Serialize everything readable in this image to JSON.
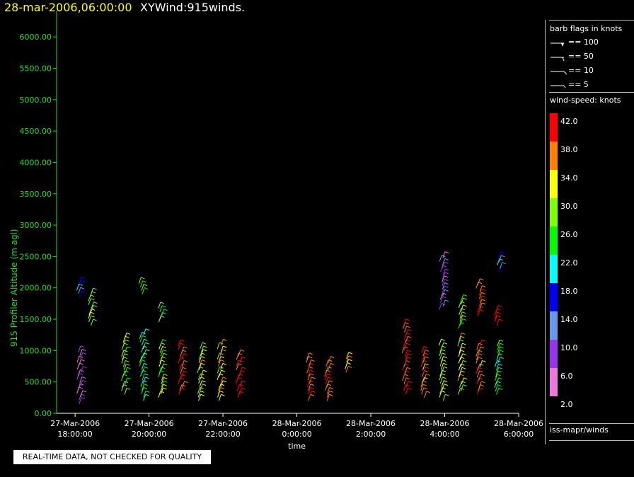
{
  "header": {
    "datetime": "28-mar-2006,06:00:00",
    "plot_name": "XYWind:915winds."
  },
  "disclaimer": "REAL-TIME DATA, NOT CHECKED FOR QUALITY",
  "legend": {
    "barb_title": "barb flags in knots",
    "barb_items": [
      "== 100",
      "== 50",
      "== 10",
      "== 5"
    ],
    "speed_title": "wind-speed: knots",
    "speed_labels": [
      "42.0",
      "38.0",
      "34.0",
      "30.0",
      "26.0",
      "22.0",
      "18.0",
      "14.0",
      "10.0",
      "6.0",
      "2.0"
    ],
    "speed_colors": [
      "#ff0000",
      "#ff8000",
      "#ffff00",
      "#80ff00",
      "#00ff00",
      "#00ffff",
      "#0000ff",
      "#6699ee",
      "#9933ee",
      "#ee77dd"
    ],
    "source": "iss-mapr/winds"
  },
  "colors": {
    "axis_y": "#22dd22",
    "axis_x": "#ffffff",
    "title_date": "#ffff00"
  },
  "chart_data": {
    "type": "scatter",
    "title": "28-mar-2006,06:00:00  XYWind:915winds.",
    "ylabel": "915 Profiler Altitude (m agl)",
    "xlabel": "time",
    "ylim": [
      0,
      6250
    ],
    "yticks": [
      "0.00",
      "500.00",
      "1000.00",
      "1500.00",
      "2000.00",
      "2500.00",
      "3000.00",
      "3500.00",
      "4000.00",
      "4500.00",
      "5000.00",
      "5500.00",
      "6000.00"
    ],
    "x_range_hours": [
      -0.25,
      6.0
    ],
    "xticks": [
      {
        "h": 0,
        "l1": "27-Mar-2006",
        "l2": "18:00:00"
      },
      {
        "h": 1,
        "l1": "27-Mar-2006",
        "l2": "20:00:00"
      },
      {
        "h": 2,
        "l1": "27-Mar-2006",
        "l2": "22:00:00"
      },
      {
        "h": 3,
        "l1": "28-Mar-2006",
        "l2": "0:00:00"
      },
      {
        "h": 4,
        "l1": "28-Mar-2006",
        "l2": "2:00:00"
      },
      {
        "h": 5,
        "l1": "28-Mar-2006",
        "l2": "4:00:00"
      },
      {
        "h": 6,
        "l1": "28-Mar-2006",
        "l2": "6:00:00"
      }
    ],
    "note_x": "tick h values are index positions of the printed 2-hourly tick labels",
    "profiles": [
      {
        "h": 0.05,
        "bottom": 150,
        "top": 1000,
        "speed": 8
      },
      {
        "h": 0.05,
        "bottom": 1850,
        "top": 2100,
        "speed": 18
      },
      {
        "h": 0.2,
        "bottom": 1400,
        "top": 1900,
        "speed": 32
      },
      {
        "h": 0.65,
        "bottom": 300,
        "top": 1200,
        "speed": 30
      },
      {
        "h": 0.9,
        "bottom": 200,
        "top": 1250,
        "speed": 26
      },
      {
        "h": 0.88,
        "bottom": 1900,
        "top": 2100,
        "speed": 28
      },
      {
        "h": 1.15,
        "bottom": 250,
        "top": 1100,
        "speed": 30
      },
      {
        "h": 1.15,
        "bottom": 1450,
        "top": 1700,
        "speed": 26
      },
      {
        "h": 1.42,
        "bottom": 300,
        "top": 1100,
        "speed": 40
      },
      {
        "h": 1.68,
        "bottom": 200,
        "top": 1050,
        "speed": 34
      },
      {
        "h": 1.95,
        "bottom": 200,
        "top": 1100,
        "speed": 34
      },
      {
        "h": 2.2,
        "bottom": 250,
        "top": 950,
        "speed": 42
      },
      {
        "h": 3.15,
        "bottom": 200,
        "top": 900,
        "speed": 42
      },
      {
        "h": 3.4,
        "bottom": 200,
        "top": 850,
        "speed": 40
      },
      {
        "h": 3.65,
        "bottom": 650,
        "top": 900,
        "speed": 36
      },
      {
        "h": 4.45,
        "bottom": 300,
        "top": 1400,
        "speed": 42
      },
      {
        "h": 4.7,
        "bottom": 250,
        "top": 1000,
        "speed": 38
      },
      {
        "h": 4.95,
        "bottom": 200,
        "top": 1100,
        "speed": 32
      },
      {
        "h": 4.95,
        "bottom": 1650,
        "top": 2500,
        "speed": 10
      },
      {
        "h": 5.2,
        "bottom": 300,
        "top": 1200,
        "speed": 34
      },
      {
        "h": 5.2,
        "bottom": 1350,
        "top": 1800,
        "speed": 30
      },
      {
        "h": 5.45,
        "bottom": 300,
        "top": 1100,
        "speed": 38
      },
      {
        "h": 5.45,
        "bottom": 1550,
        "top": 2050,
        "speed": 40
      },
      {
        "h": 5.7,
        "bottom": 300,
        "top": 1100,
        "speed": 26
      },
      {
        "h": 5.7,
        "bottom": 1400,
        "top": 1650,
        "speed": 42
      },
      {
        "h": 5.72,
        "bottom": 2250,
        "top": 2500,
        "speed": 18
      }
    ]
  }
}
